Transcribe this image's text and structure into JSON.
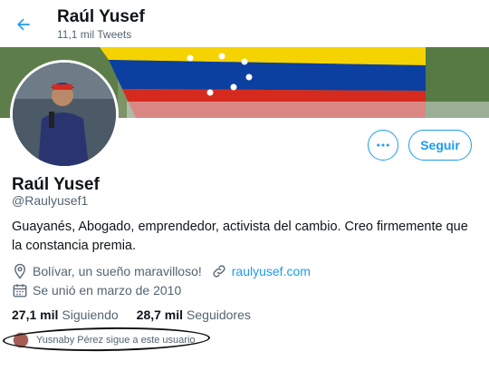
{
  "header": {
    "title": "Raúl Yusef",
    "tweet_count": "11,1 mil Tweets",
    "back_icon": "arrow-left-icon"
  },
  "profile": {
    "name": "Raúl Yusef",
    "handle": "@Raulyusef1",
    "bio": "Guayanés, Abogado, emprendedor, activista del cambio. Creo firmemente que la constancia premia.",
    "location": "Bolívar, un sueño maravilloso!",
    "website": "raulyusef.com",
    "joined": "Se unió en marzo de 2010"
  },
  "actions": {
    "more_icon": "ellipsis-icon",
    "follow_label": "Seguir"
  },
  "stats": {
    "following_count": "27,1 mil",
    "following_label": "Siguiendo",
    "followers_count": "28,7 mil",
    "followers_label": "Seguidores"
  },
  "followed_by": "Yusnaby Pérez sigue a este usuario",
  "colors": {
    "accent": "#1d9bf0",
    "text": "#0f1419",
    "muted": "#536471",
    "flag_yellow": "#f5d300",
    "flag_blue": "#0b3fa0",
    "flag_red": "#d52b1e"
  }
}
